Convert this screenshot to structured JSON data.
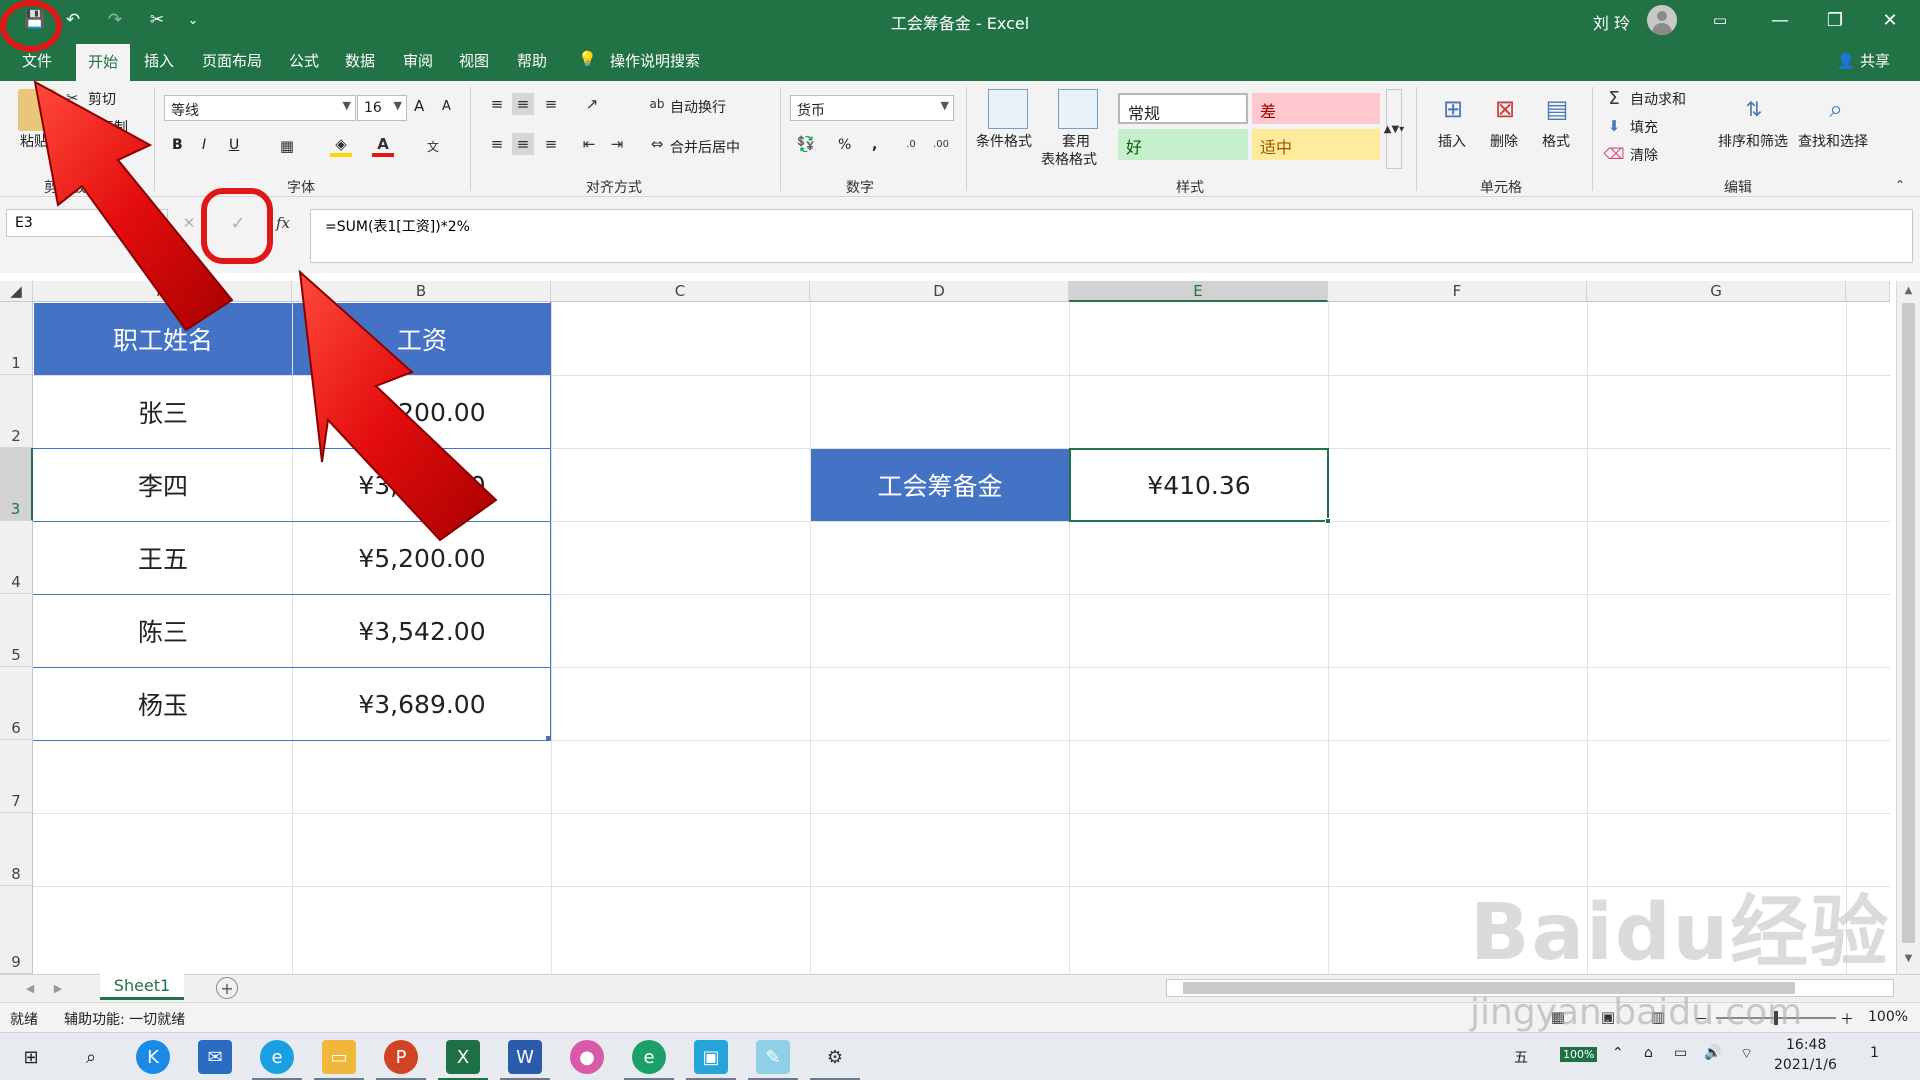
{
  "window": {
    "title": "工会筹备金 - Excel",
    "user": "刘 玲",
    "controls": {
      "minimize": "—",
      "restore": "❐",
      "close": "✕"
    }
  },
  "qat": {
    "save_icon": "💾",
    "undo_icon": "↶",
    "redo_icon": "↷",
    "cut_icon": "✂",
    "more_icon": "⌄"
  },
  "menu": {
    "tabs": [
      "文件",
      "开始",
      "插入",
      "页面布局",
      "公式",
      "数据",
      "审阅",
      "视图",
      "帮助"
    ],
    "active_tab": "开始",
    "search": "操作说明搜索",
    "share": "共享"
  },
  "ribbon": {
    "clipboard": {
      "paste": "粘贴",
      "cut": "剪切",
      "copy": "复制",
      "label": "剪贴板"
    },
    "font": {
      "name": "等线",
      "size": "16",
      "bold": "B",
      "italic": "I",
      "underline": "U",
      "grow": "A",
      "shrink": "A",
      "label": "字体"
    },
    "alignment": {
      "wrap": "自动换行",
      "merge": "合并后居中",
      "label": "对齐方式"
    },
    "number": {
      "format": "货币",
      "percent": "%",
      "comma": ",",
      "label": "数字"
    },
    "styles": {
      "conditional": "条件格式",
      "table_format_1": "套用",
      "table_format_2": "表格格式",
      "normal": "常规",
      "bad": "差",
      "good": "好",
      "neutral": "适中",
      "label": "样式"
    },
    "cells": {
      "insert": "插入",
      "delete": "删除",
      "format": "格式",
      "label": "单元格"
    },
    "editing": {
      "autosum": "自动求和",
      "fill": "填充",
      "clear": "清除",
      "sort": "排序和筛选",
      "find": "查找和选择",
      "label": "编辑"
    }
  },
  "formula_bar": {
    "name_box": "E3",
    "cancel": "✕",
    "enter": "✓",
    "fx": "fx",
    "formula": "=SUM(表1[工资])*2%"
  },
  "grid": {
    "columns": [
      "A",
      "B",
      "C",
      "D",
      "E",
      "F",
      "G"
    ],
    "rows": [
      "1",
      "2",
      "3",
      "4",
      "5",
      "6",
      "7",
      "8",
      "9"
    ],
    "table": {
      "headers": [
        "职工姓名",
        "工资"
      ],
      "rows": [
        [
          "张三",
          "¥3,200.00"
        ],
        [
          "李四",
          "¥3,887.00"
        ],
        [
          "王五",
          "¥5,200.00"
        ],
        [
          "陈三",
          "¥3,542.00"
        ],
        [
          "杨玉",
          "¥3,689.00"
        ]
      ]
    },
    "summary_label": "工会筹备金",
    "summary_value": "¥410.36"
  },
  "sheets": {
    "active": "Sheet1",
    "add": "+"
  },
  "status": {
    "ready": "就绪",
    "accessibility": "辅助功能: 一切就绪",
    "zoom": "100%"
  },
  "taskbar": {
    "time": "16:48",
    "date": "2021/1/6",
    "battery": "100%",
    "notify": "1"
  },
  "watermark": {
    "brand": "Baidu经验",
    "url": "jingyan.baidu.com"
  },
  "colors": {
    "excel_green": "#217346",
    "table_blue": "#4472c4",
    "annotation_red": "#e01717"
  }
}
